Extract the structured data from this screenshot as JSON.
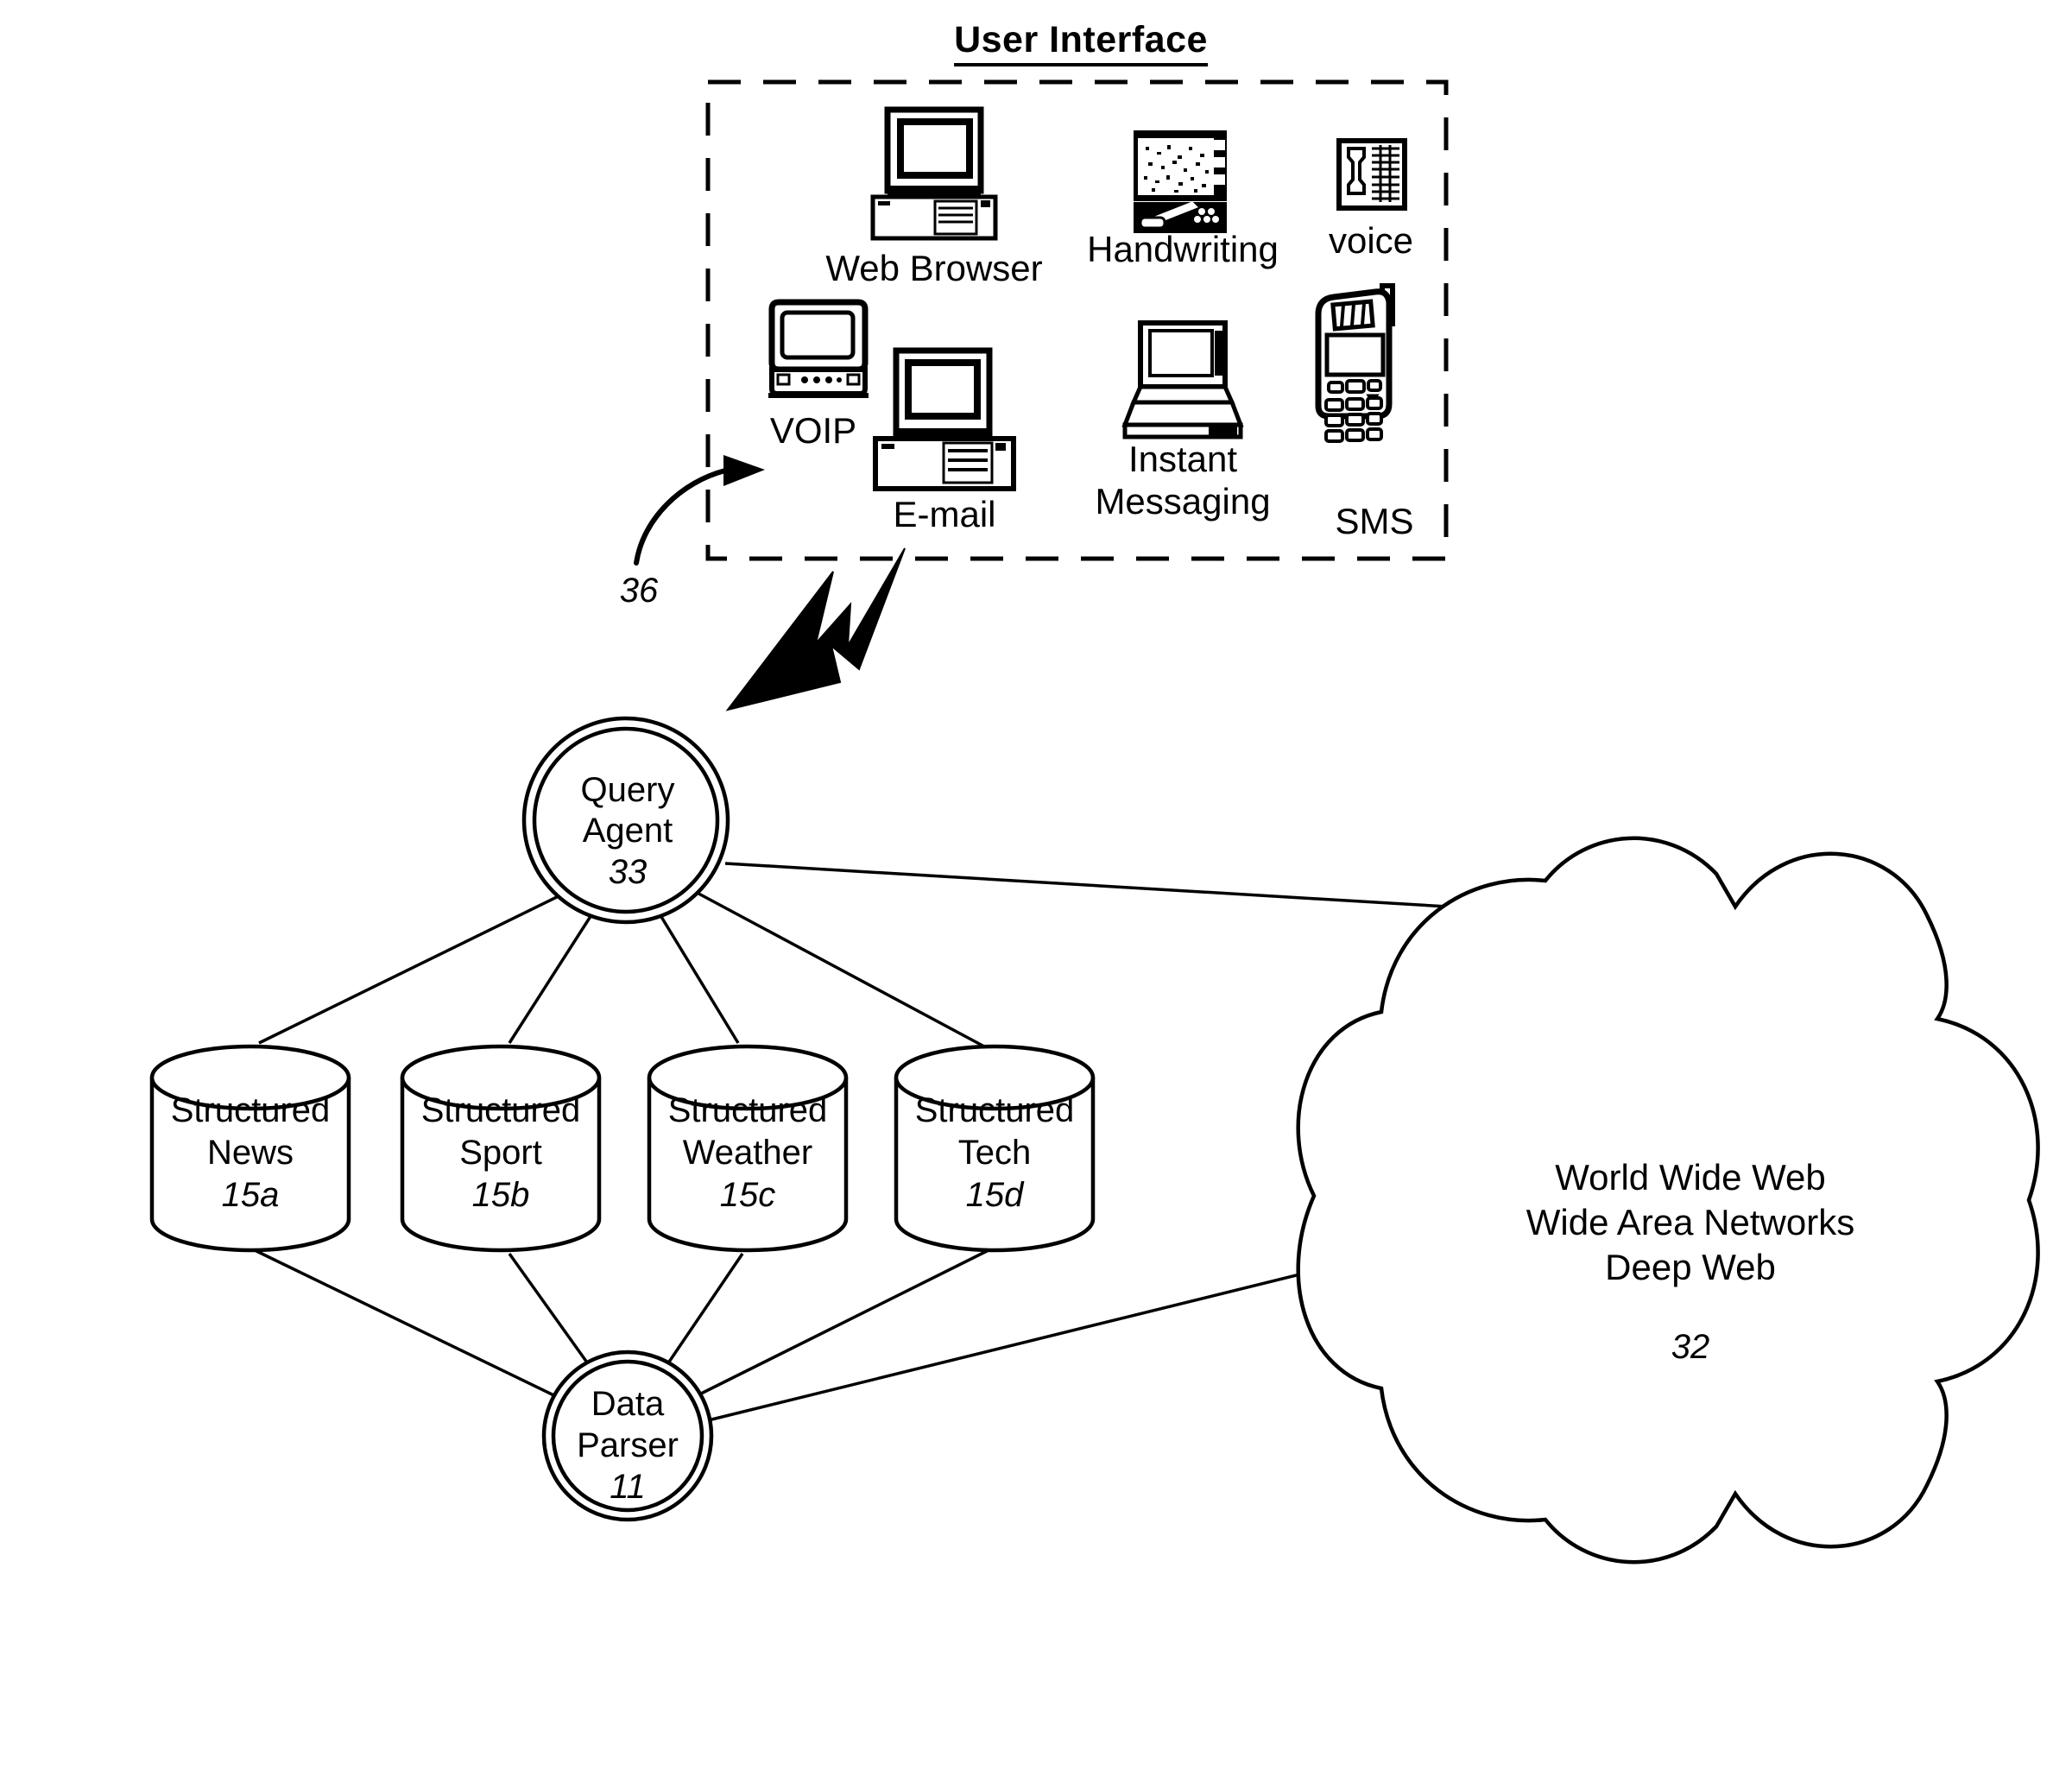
{
  "figure": {
    "ui_panel": {
      "title": "User Interface",
      "ref": "36",
      "items": [
        {
          "label": "Web Browser",
          "icon": "desktop-computer-icon"
        },
        {
          "label": "Handwriting",
          "icon": "tablet-handwriting-icon"
        },
        {
          "label": "voice",
          "icon": "telephone-icon"
        },
        {
          "label": "VOIP",
          "icon": "crt-monitor-icon"
        },
        {
          "label": "E-mail",
          "icon": "desktop-computer-icon"
        },
        {
          "label": "Instant\nMessaging",
          "icon": "laptop-icon"
        },
        {
          "label": "SMS",
          "icon": "mobile-phone-icon"
        }
      ]
    },
    "nodes": {
      "query_agent": {
        "line1": "Query",
        "line2": "Agent",
        "ref": "33"
      },
      "data_parser": {
        "line1": "Data",
        "line2": "Parser",
        "ref": "11"
      },
      "cloud": {
        "line1": "World Wide Web",
        "line2": "Wide Area Networks",
        "line3": "Deep Web",
        "ref": "32"
      }
    },
    "databases": [
      {
        "line1": "Structured",
        "line2": "News",
        "ref": "15a"
      },
      {
        "line1": "Structured",
        "line2": "Sport",
        "ref": "15b"
      },
      {
        "line1": "Structured",
        "line2": "Weather",
        "ref": "15c"
      },
      {
        "line1": "Structured",
        "line2": "Tech",
        "ref": "15d"
      }
    ],
    "labels": {
      "instant": "Instant",
      "messaging": "Messaging"
    },
    "colors": {
      "ink": "#000000",
      "paper": "#ffffff"
    }
  }
}
